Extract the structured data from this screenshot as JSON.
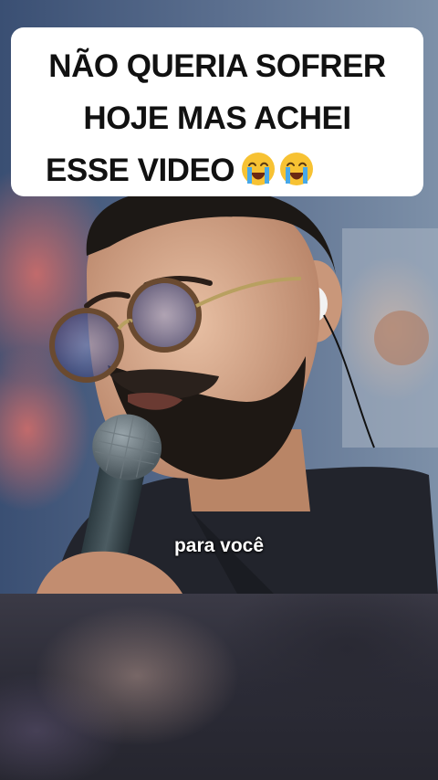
{
  "overlay": {
    "caption_line1": "NÃO QUERIA SOFRER",
    "caption_line2": "HOJE MAS ACHEI",
    "caption_line3": "ESSE VIDEO",
    "caption_emoji": "loudly-crying-face-icon"
  },
  "video": {
    "subtitle": "para você"
  }
}
